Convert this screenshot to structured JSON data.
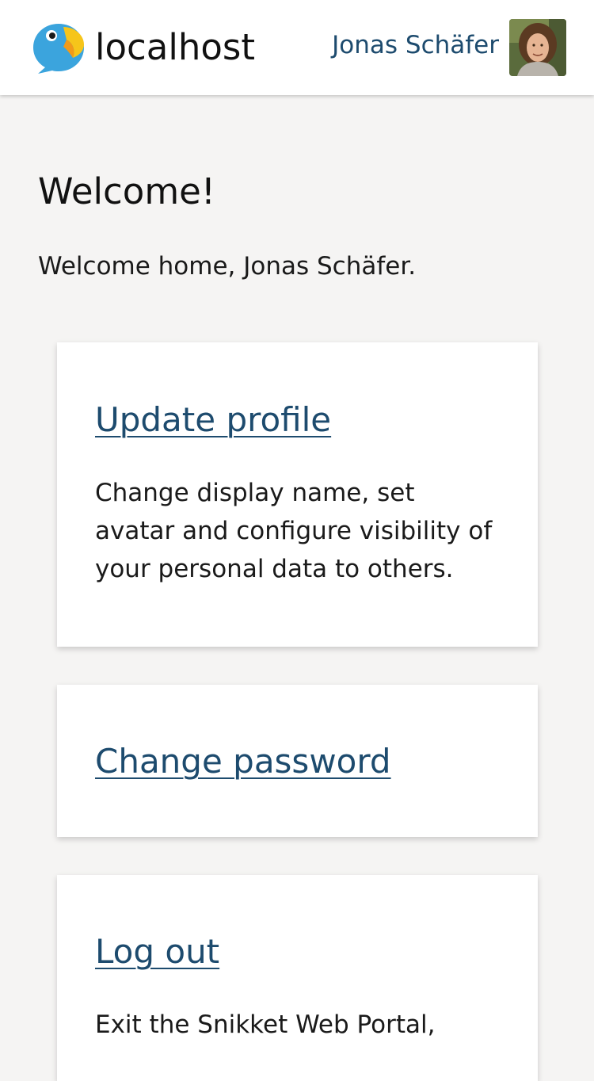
{
  "header": {
    "site_name": "localhost",
    "user_name": "Jonas Schäfer"
  },
  "main": {
    "title": "Welcome!",
    "intro": "Welcome home, Jonas Schäfer.",
    "cards": [
      {
        "title": "Update profile",
        "description": "Change display name, set avatar and configure visibility of your personal data to others."
      },
      {
        "title": "Change password",
        "description": ""
      },
      {
        "title": "Log out",
        "description": "Exit the Snikket Web Portal,"
      }
    ]
  },
  "colors": {
    "link": "#1d4b6e",
    "page_background": "#f5f4f3",
    "card_background": "#ffffff"
  }
}
